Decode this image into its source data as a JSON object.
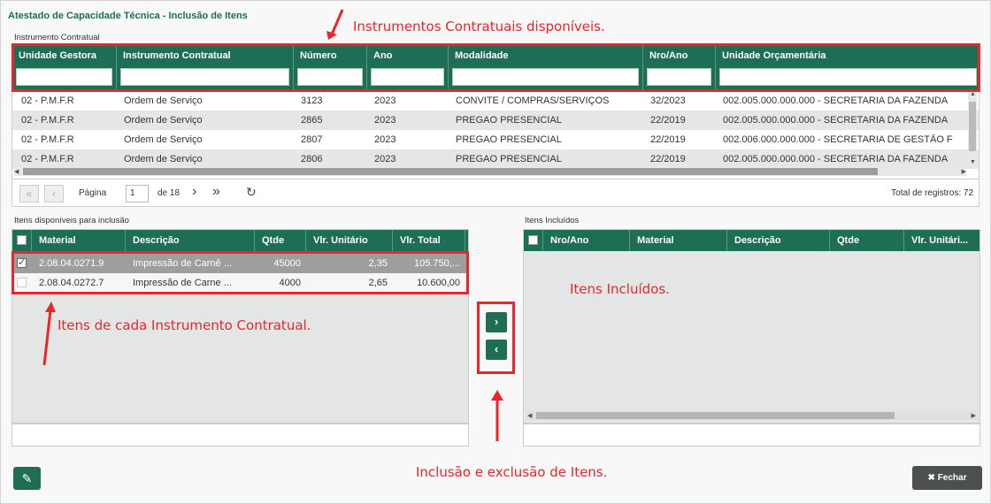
{
  "window_title": "Atestado de Capacidade Técnica - Inclusão de Itens",
  "contract_section": {
    "label": "Instrumento Contratual",
    "columns": [
      "Unidade Gestora",
      "Instrumento Contratual",
      "Número",
      "Ano",
      "Modalidade",
      "Nro/Ano",
      "Unidade Orçamentária"
    ],
    "rows": [
      [
        "02 - P.M.F.R",
        "Ordem de Serviço",
        "3123",
        "2023",
        "CONVITE / COMPRAS/SERVIÇOS",
        "32/2023",
        "002.005.000.000.000 - SECRETARIA DA FAZENDA"
      ],
      [
        "02 - P.M.F.R",
        "Ordem de Serviço",
        "2865",
        "2023",
        "PREGAO PRESENCIAL",
        "22/2019",
        "002.005.000.000.000 - SECRETARIA DA FAZENDA"
      ],
      [
        "02 - P.M.F.R",
        "Ordem de Serviço",
        "2807",
        "2023",
        "PREGAO PRESENCIAL",
        "22/2019",
        "002.006.000.000.000 - SECRETARIA DE GESTÃO F"
      ],
      [
        "02 - P.M.F.R",
        "Ordem de Serviço",
        "2806",
        "2023",
        "PREGAO PRESENCIAL",
        "22/2019",
        "002.005.000.000.000 - SECRETARIA DA FAZENDA"
      ]
    ]
  },
  "pager": {
    "page_label": "Página",
    "page_value": "1",
    "of_label": "de 18",
    "total_label": "Total de registros: 72"
  },
  "available_items": {
    "label": "Itens disponíveis para inclusão",
    "columns": [
      "Material",
      "Descrição",
      "Qtde",
      "Vlr. Unitário",
      "Vlr. Total"
    ],
    "rows": [
      {
        "checked": true,
        "cells": [
          "2.08.04.0271.9",
          "Impressão de Carnê ...",
          "45000",
          "2,35",
          "105.750,..."
        ]
      },
      {
        "checked": false,
        "cells": [
          "2.08.04.0272.7",
          "Impressão de Carne ...",
          "4000",
          "2,65",
          "10.600,00"
        ]
      }
    ]
  },
  "included_items": {
    "label": "Itens Incluídos",
    "columns": [
      "Nro/Ano",
      "Material",
      "Descrição",
      "Qtde",
      "Vlr. Unitári..."
    ]
  },
  "buttons": {
    "include": "›",
    "exclude": "‹",
    "close_label": "Fechar"
  },
  "annotations": {
    "contracts": "Instrumentos Contratuais disponíveis.",
    "items_per_contract": "Itens de cada Instrumento Contratual.",
    "included": "Itens Incluídos.",
    "include_exclude": "Inclusão e exclusão de Itens."
  },
  "colors": {
    "header_green": "#1e6e56",
    "annotation_red": "#e8262b"
  }
}
